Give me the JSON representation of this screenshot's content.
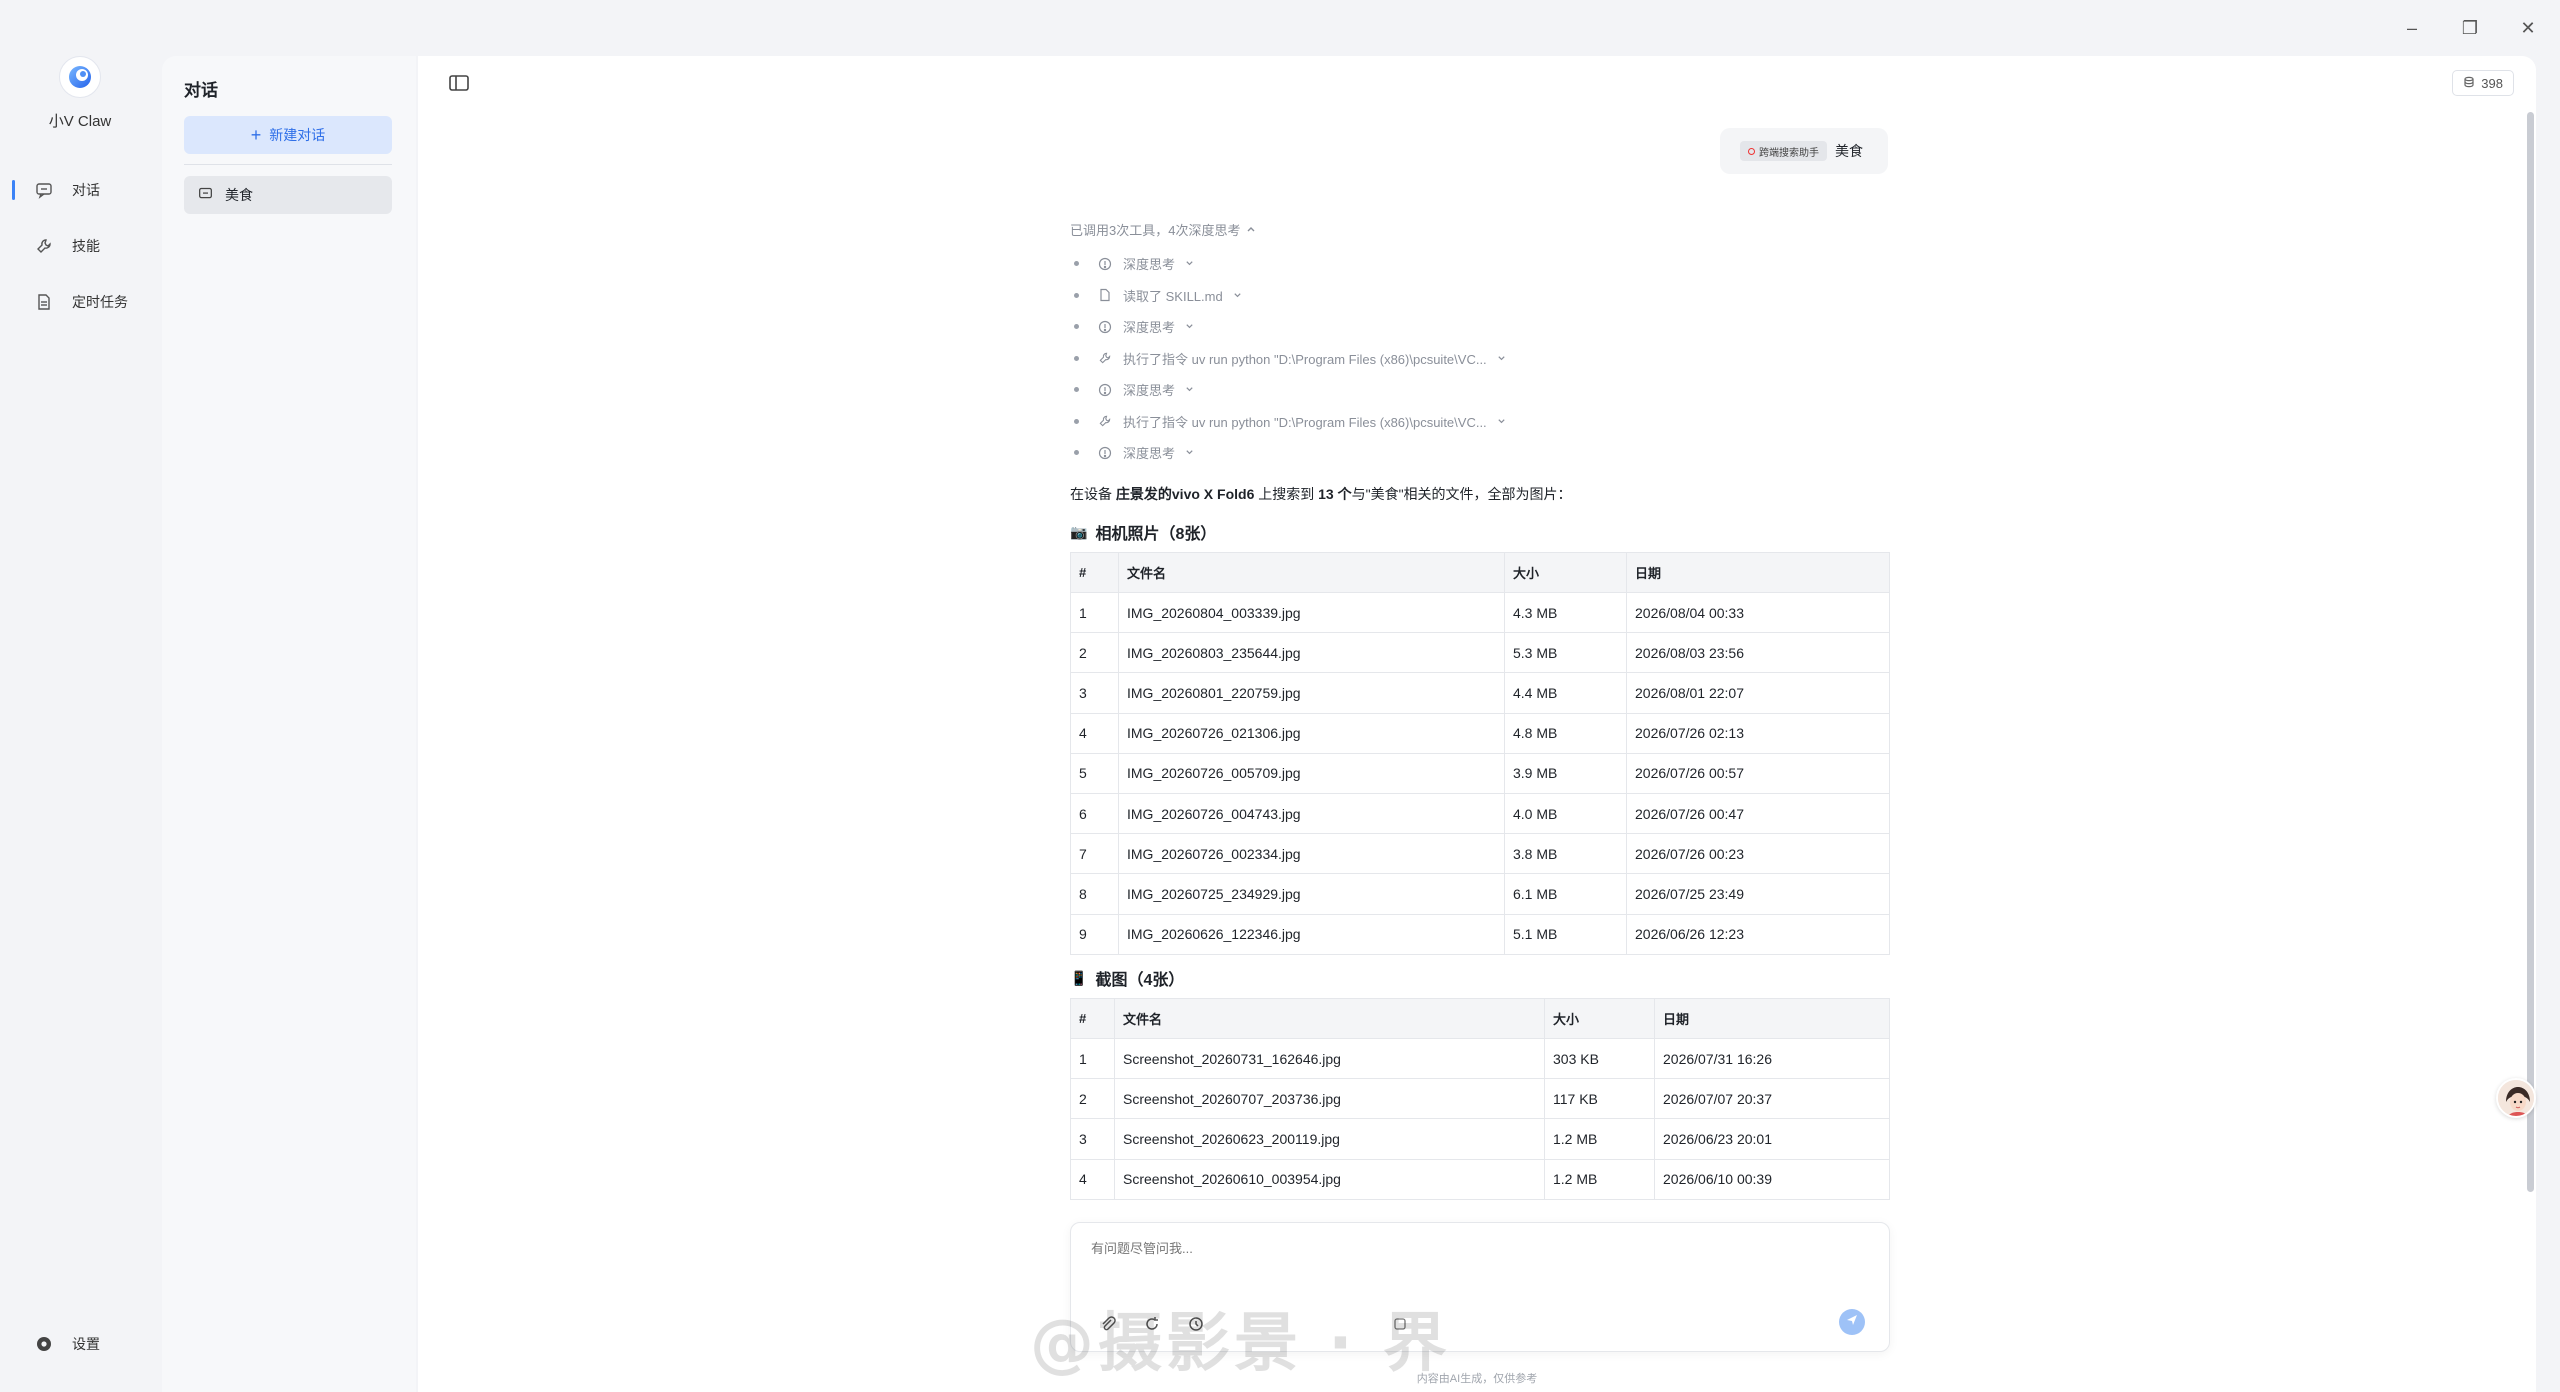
{
  "window": {
    "minimize": "–",
    "restore": "❐",
    "close": "✕"
  },
  "brand": {
    "name": "小V Claw"
  },
  "rail": {
    "items": [
      {
        "label": "对话",
        "icon": "chat-icon"
      },
      {
        "label": "技能",
        "icon": "wrench-icon"
      },
      {
        "label": "定时任务",
        "icon": "document-icon"
      }
    ],
    "settings_label": "设置"
  },
  "conversations": {
    "title": "对话",
    "new_chat_label": "新建对话",
    "items": [
      {
        "label": "美食"
      }
    ]
  },
  "header": {
    "token_count": "398"
  },
  "user_message": {
    "tool_chip": "跨端搜索助手",
    "text": "美食"
  },
  "trace": {
    "summary": "已调用3次工具，4次深度思考",
    "items": [
      {
        "icon": "thinking-icon",
        "text": "深度思考"
      },
      {
        "icon": "file-icon",
        "text": "读取了 SKILL.md"
      },
      {
        "icon": "thinking-icon",
        "text": "深度思考"
      },
      {
        "icon": "tool-icon",
        "text": "执行了指令 uv run python \"D:\\Program Files (x86)\\pcsuite\\VC..."
      },
      {
        "icon": "thinking-icon",
        "text": "深度思考"
      },
      {
        "icon": "tool-icon",
        "text": "执行了指令 uv run python \"D:\\Program Files (x86)\\pcsuite\\VC..."
      },
      {
        "icon": "thinking-icon",
        "text": "深度思考"
      }
    ]
  },
  "answer": {
    "intro_prefix": "在设备 ",
    "device": "庄景发的vivo X Fold6",
    "intro_mid": " 上搜索到 ",
    "count": "13 个",
    "intro_suffix": "与\"美食\"相关的文件，全部为图片："
  },
  "camera_section": {
    "emoji": "📷",
    "title": "相机照片（8张）",
    "headers": [
      "#",
      "文件名",
      "大小",
      "日期"
    ],
    "rows": [
      [
        "1",
        "IMG_20260804_003339.jpg",
        "4.3 MB",
        "2026/08/04 00:33"
      ],
      [
        "2",
        "IMG_20260803_235644.jpg",
        "5.3 MB",
        "2026/08/03 23:56"
      ],
      [
        "3",
        "IMG_20260801_220759.jpg",
        "4.4 MB",
        "2026/08/01 22:07"
      ],
      [
        "4",
        "IMG_20260726_021306.jpg",
        "4.8 MB",
        "2026/07/26 02:13"
      ],
      [
        "5",
        "IMG_20260726_005709.jpg",
        "3.9 MB",
        "2026/07/26 00:57"
      ],
      [
        "6",
        "IMG_20260726_004743.jpg",
        "4.0 MB",
        "2026/07/26 00:47"
      ],
      [
        "7",
        "IMG_20260726_002334.jpg",
        "3.8 MB",
        "2026/07/26 00:23"
      ],
      [
        "8",
        "IMG_20260725_234929.jpg",
        "6.1 MB",
        "2026/07/25 23:49"
      ],
      [
        "9",
        "IMG_20260626_122346.jpg",
        "5.1 MB",
        "2026/06/26 12:23"
      ]
    ]
  },
  "screenshot_section": {
    "emoji": "📱",
    "title": "截图（4张）",
    "headers": [
      "#",
      "文件名",
      "大小",
      "日期"
    ],
    "rows": [
      [
        "1",
        "Screenshot_20260731_162646.jpg",
        "303 KB",
        "2026/07/31 16:26"
      ],
      [
        "2",
        "Screenshot_20260707_203736.jpg",
        "117 KB",
        "2026/07/07 20:37"
      ],
      [
        "3",
        "Screenshot_20260623_200119.jpg",
        "1.2 MB",
        "2026/06/23 20:01"
      ],
      [
        "4",
        "Screenshot_20260610_003954.jpg",
        "1.2 MB",
        "2026/06/10 00:39"
      ]
    ]
  },
  "composer": {
    "placeholder": "有问题尽管问我..."
  },
  "disclaimer": "内容由AI生成，仅供参考",
  "watermark": "@摄影景 · 界",
  "colors": {
    "accent": "#3b82f6",
    "new_chat_bg": "#dbe7fd",
    "send_btn": "#9ec2f7"
  }
}
